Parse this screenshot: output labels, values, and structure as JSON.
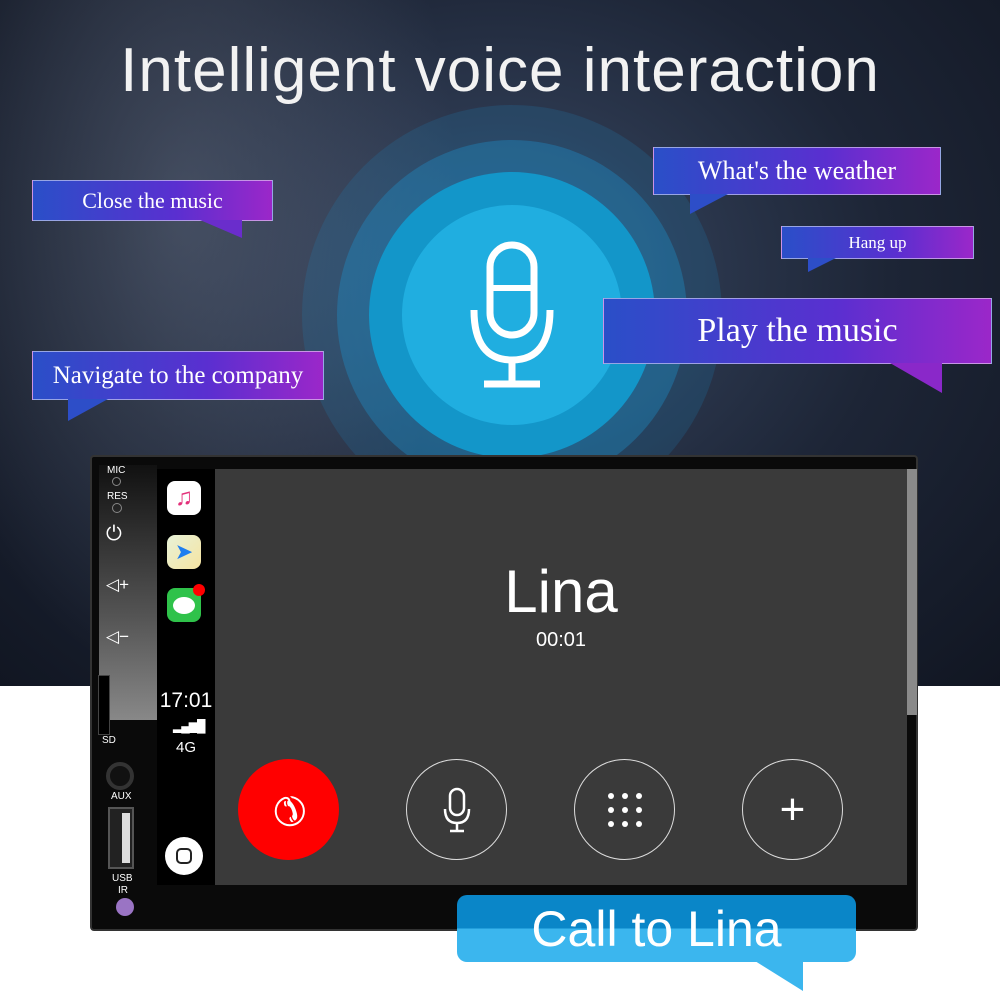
{
  "headline": "Intelligent voice interaction",
  "bubbles": {
    "close_music": "Close the music",
    "weather": "What's the weather",
    "hang_up": "Hang up",
    "play_music": "Play the music",
    "navigate": "Navigate to the company",
    "call": "Call to Lina"
  },
  "device": {
    "labels": {
      "mic": "MIC",
      "res": "RES",
      "sd": "SD",
      "aux": "AUX",
      "usb": "USB",
      "ir": "IR"
    },
    "carplay": {
      "time": "17:01",
      "network": "4G",
      "apps": [
        "music-icon",
        "maps-icon",
        "messages-icon"
      ]
    },
    "call": {
      "name": "Lina",
      "duration": "00:01",
      "buttons": [
        "end-call",
        "mute",
        "keypad",
        "add-call"
      ]
    }
  },
  "colors": {
    "end_call": "#ff0000",
    "call_bubble": "#2ea8e6",
    "mic_glow": "#1aa0d8"
  }
}
